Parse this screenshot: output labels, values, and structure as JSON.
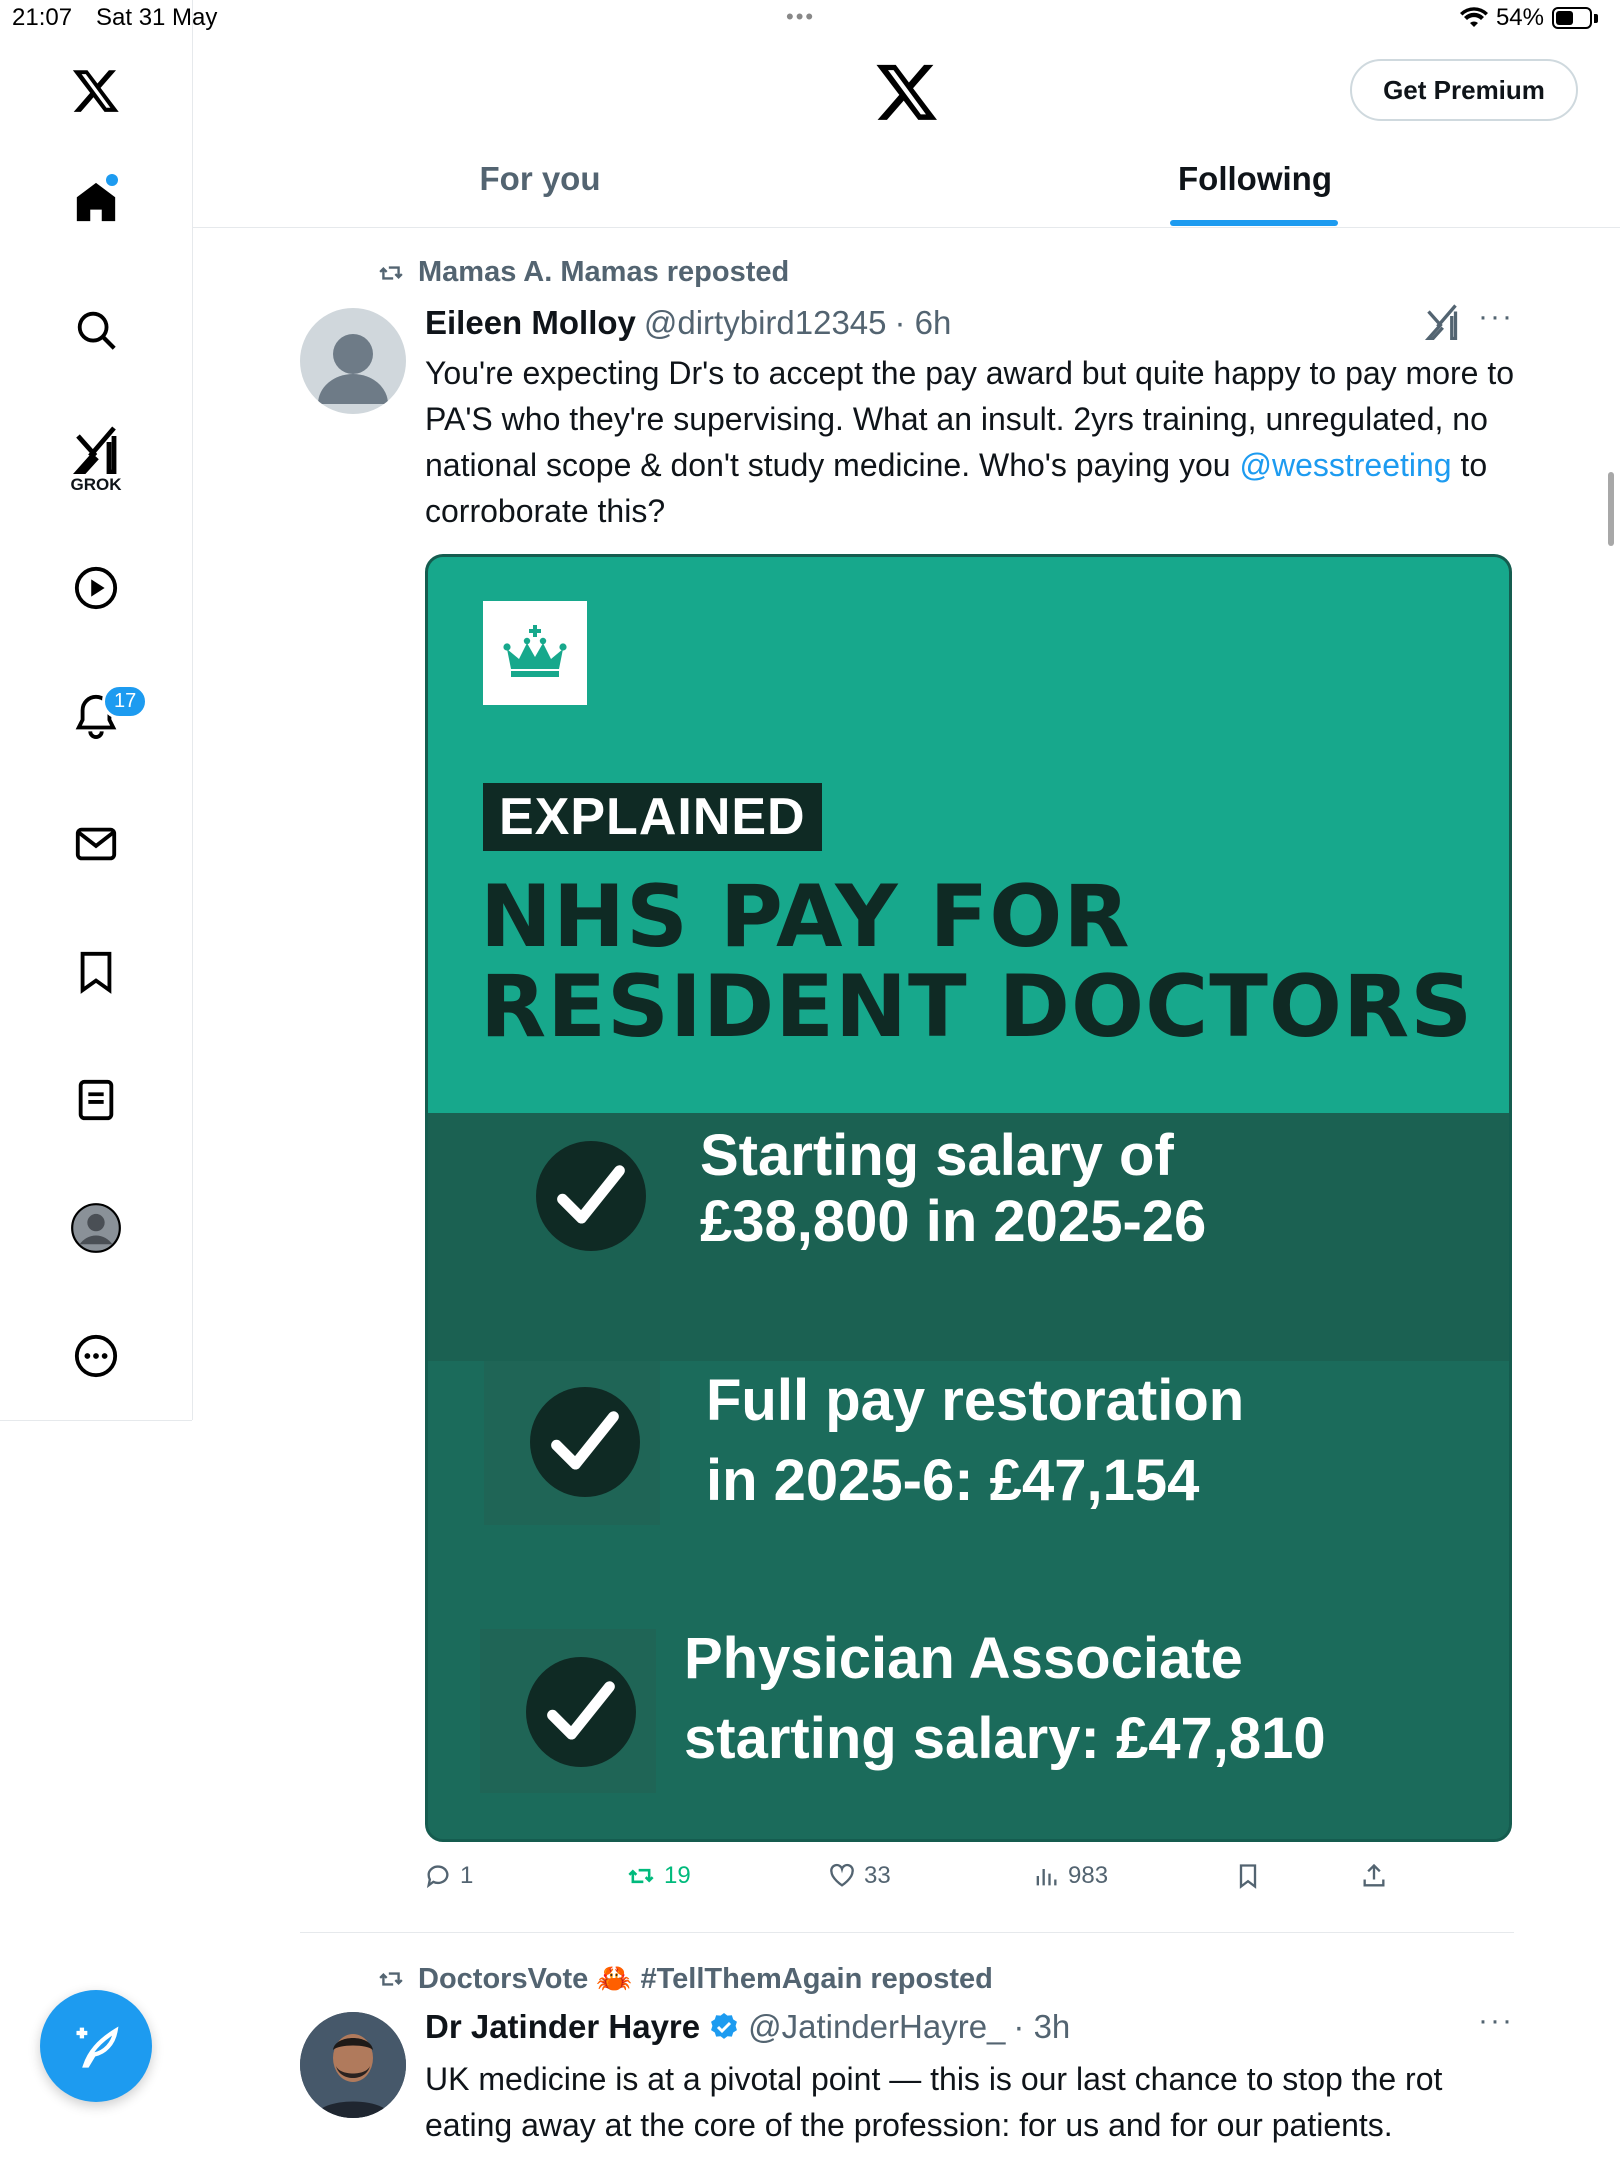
{
  "status_bar": {
    "time": "21:07",
    "date": "Sat 31 May",
    "battery": "54%",
    "battery_level": 0.54
  },
  "header": {
    "premium_label": "Get Premium",
    "tabs": [
      {
        "label": "For you"
      },
      {
        "label": "Following"
      }
    ],
    "active_tab": "Following"
  },
  "sidebar": {
    "grok_label": "GROK",
    "notifications_badge": "17",
    "items": [
      "x-logo",
      "home-icon",
      "search-icon",
      "grok-icon",
      "video-icon",
      "bell-icon",
      "mail-icon",
      "bookmark-icon",
      "lists-icon",
      "profile-icon",
      "more-icon"
    ]
  },
  "tweet1": {
    "repost_by": "Mamas A. Mamas reposted",
    "name": "Eileen Molloy",
    "handle": "@dirtybird12345",
    "time": "· 6h",
    "text_before": "You're expecting Dr's to accept the pay award but quite happy to pay more to PA'S who they're supervising. What an insult. 2yrs training, unregulated, no national scope & don't study medicine. Who's paying you ",
    "mention": "@wesstreeting",
    "text_after": " to corroborate this?",
    "image": {
      "tag": "EXPLAINED",
      "headline_1": "NHS PAY FOR",
      "headline_2": "RESIDENT DOCTORS",
      "items": [
        {
          "line1": "Starting salary of",
          "line2": "£38,800 in 2025-26"
        },
        {
          "line1": "Full pay restoration",
          "line2": "in 2025-6: £47,154"
        },
        {
          "line1": "Physician Associate",
          "line2": "starting salary: £47,810"
        }
      ]
    },
    "actions": {
      "replies": "1",
      "reposts": "19",
      "likes": "33",
      "views": "983"
    },
    "repost_color": "#00ba7c"
  },
  "tweet2": {
    "repost_by": "DoctorsVote 🦀 #TellThemAgain reposted",
    "name": "Dr Jatinder Hayre",
    "handle": "@JatinderHayre_",
    "time": "· 3h",
    "text": "UK medicine is at a pivotal point — this is our last chance to stop the rot eating away at the core of the profession: for us and for our patients."
  },
  "colors": {
    "accent": "#1d9bf0",
    "card_teal": "#17a88c",
    "card_dark": "#1b6b5b"
  }
}
